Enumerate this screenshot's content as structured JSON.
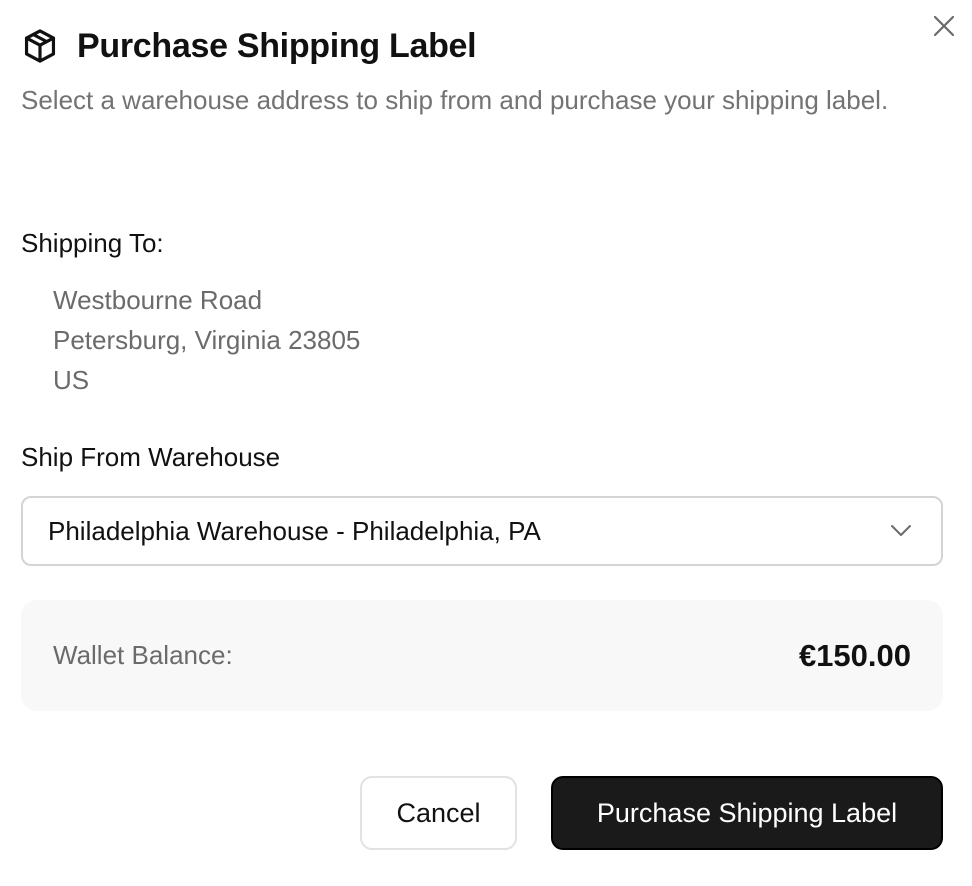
{
  "dialog": {
    "title": "Purchase Shipping Label",
    "subtitle": "Select a warehouse address to ship from and purchase your shipping label.",
    "close_icon": "close-icon",
    "header_icon": "package-icon"
  },
  "shipping_to": {
    "label": "Shipping To:",
    "address_lines": [
      "Westbourne Road",
      "Petersburg, Virginia 23805",
      "US"
    ]
  },
  "ship_from": {
    "label": "Ship From Warehouse",
    "selected": "Philadelphia Warehouse - Philadelphia, PA",
    "icon": "chevron-down-icon"
  },
  "wallet": {
    "label": "Wallet Balance:",
    "amount": "€150.00"
  },
  "actions": {
    "cancel_label": "Cancel",
    "primary_label": "Purchase Shipping Label",
    "primary_color": "#1a1a1a"
  }
}
